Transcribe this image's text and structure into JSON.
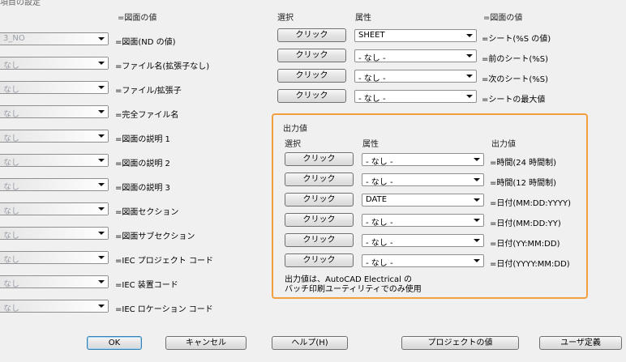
{
  "dialog": {
    "title_fragment": "項目の設定"
  },
  "left": {
    "header_value": "=図面の値",
    "rows": [
      {
        "combo": "3_NO",
        "label": "=図面(ND の値)"
      },
      {
        "combo": "なし",
        "label": "=ファイル名(拡張子なし)"
      },
      {
        "combo": "なし",
        "label": "=ファイル/拡張子"
      },
      {
        "combo": "なし",
        "label": "=完全ファイル名"
      },
      {
        "combo": "なし",
        "label": "=図面の説明 1"
      },
      {
        "combo": "なし",
        "label": "=図面の説明 2"
      },
      {
        "combo": "なし",
        "label": "=図面の説明 3"
      },
      {
        "combo": "なし",
        "label": "=図面セクション"
      },
      {
        "combo": "なし",
        "label": "=図面サブセクション"
      },
      {
        "combo": "なし",
        "label": "=IEC プロジェクト コード"
      },
      {
        "combo": "なし",
        "label": "=IEC 装置コード"
      },
      {
        "combo": "なし",
        "label": "=IEC ロケーション コード"
      }
    ]
  },
  "sheet": {
    "header_select": "選択",
    "header_attr": "属性",
    "header_value": "=図面の値",
    "rows": [
      {
        "button": "クリック",
        "combo": "SHEET",
        "label": "=シート(%S の値)"
      },
      {
        "button": "クリック",
        "combo": "- なし -",
        "label": "=前のシート(%S)"
      },
      {
        "button": "クリック",
        "combo": "- なし -",
        "label": "=次のシート(%S)"
      },
      {
        "button": "クリック",
        "combo": "- なし -",
        "label": "=シートの最大値"
      }
    ]
  },
  "output": {
    "group_title": "出力値",
    "header_select": "選択",
    "header_attr": "属性",
    "header_value": "出力値",
    "rows": [
      {
        "button": "クリック",
        "combo": "- なし -",
        "label": "=時間(24 時間制)"
      },
      {
        "button": "クリック",
        "combo": "- なし -",
        "label": "=時間(12 時間制)"
      },
      {
        "button": "クリック",
        "combo": "DATE",
        "label": "=日付(MM:DD:YYYY)"
      },
      {
        "button": "クリック",
        "combo": "- なし -",
        "label": "=日付(MM:DD:YY)"
      },
      {
        "button": "クリック",
        "combo": "- なし -",
        "label": "=日付(YY:MM:DD)"
      },
      {
        "button": "クリック",
        "combo": "- なし -",
        "label": "=日付(YYYY:MM:DD)"
      }
    ],
    "note_line1": "出力値は、AutoCAD Electrical の",
    "note_line2": "バッチ印刷ユーティリティでのみ使用"
  },
  "footer": {
    "ok": "OK",
    "cancel": "キャンセル",
    "help": "ヘルプ(H)",
    "project_values": "プロジェクトの値",
    "user_defined": "ユーザ定義"
  },
  "colors": {
    "highlight_border": "#f2a03d",
    "background": "#f0f0f0"
  }
}
